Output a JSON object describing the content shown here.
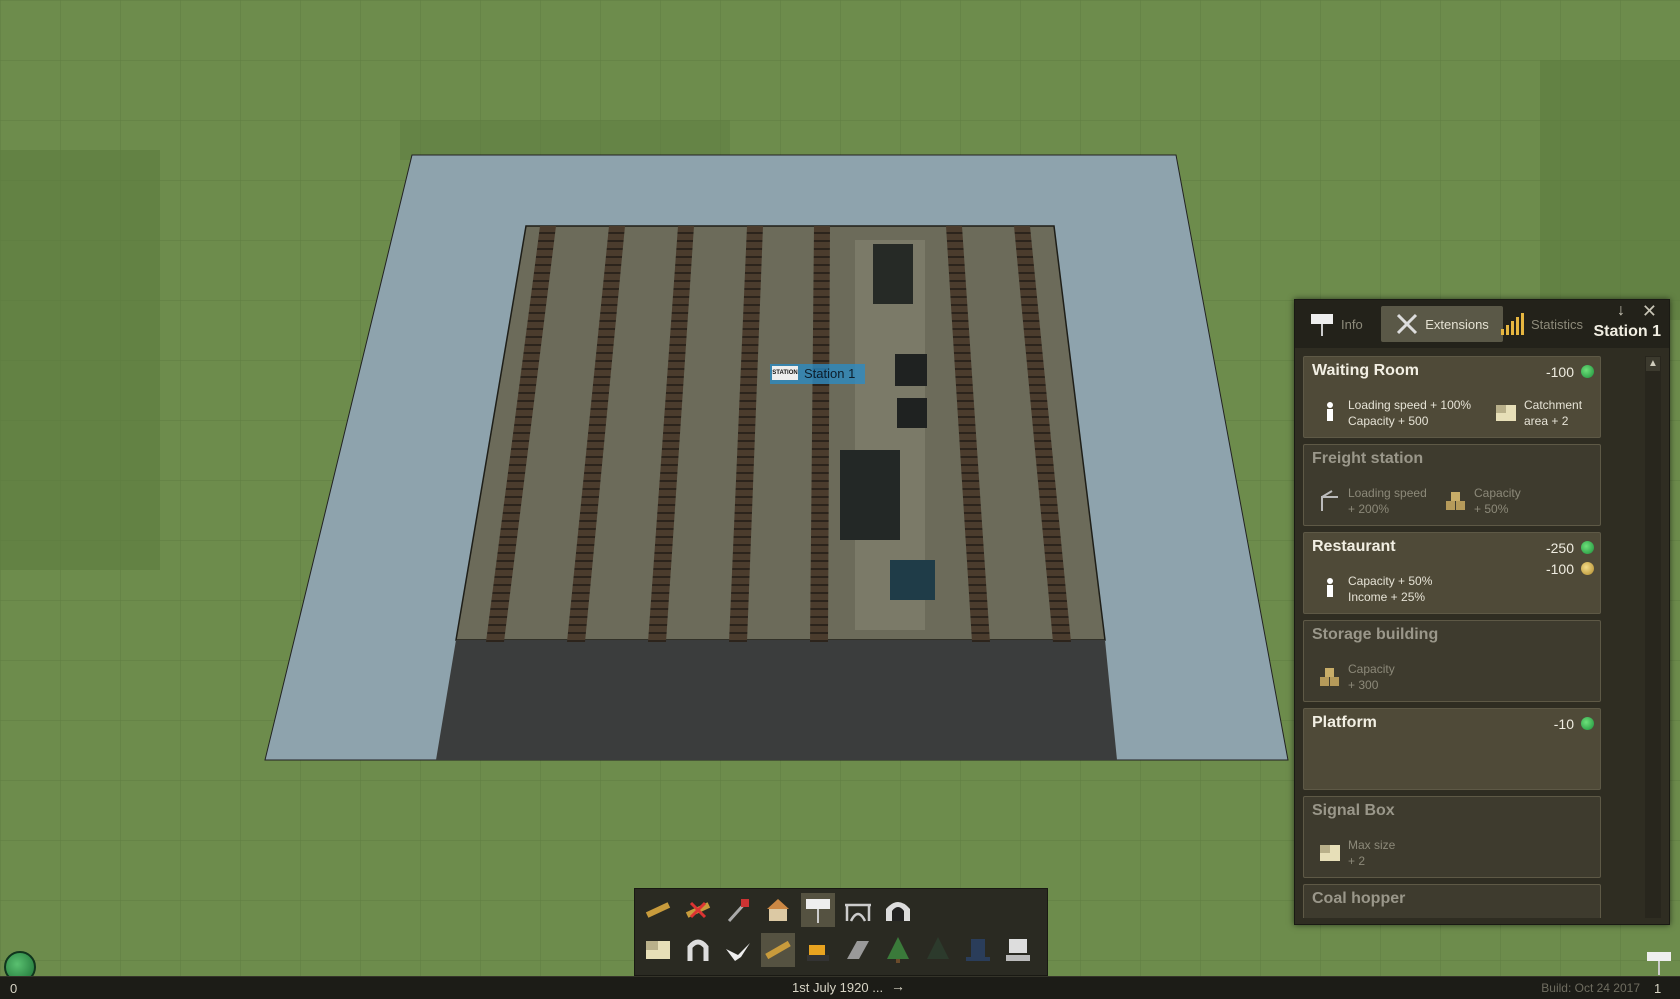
{
  "world": {
    "station_label": "Station 1",
    "station_sign_text": "STATION"
  },
  "panel": {
    "title": "Station 1",
    "tabs": [
      {
        "label": "Info",
        "icon": "station-sign-icon",
        "active": false
      },
      {
        "label": "Extensions",
        "icon": "wrench-screwdriver-icon",
        "active": true
      },
      {
        "label": "Statistics",
        "icon": "bar-chart-icon",
        "active": false
      }
    ],
    "extensions": [
      {
        "name": "Waiting Room",
        "available": true,
        "costs": [
          {
            "value": "-100",
            "currency": "green"
          }
        ],
        "bonuses": [
          {
            "icon": "passenger-icon",
            "lines": [
              "Loading speed + 100%",
              "Capacity + 500"
            ]
          },
          {
            "icon": "catchment-area-icon",
            "lines": [
              "Catchment",
              "area + 2"
            ]
          }
        ]
      },
      {
        "name": "Freight station",
        "available": false,
        "costs": [],
        "bonuses": [
          {
            "icon": "crane-icon",
            "lines": [
              "Loading speed",
              "+ 200%"
            ]
          },
          {
            "icon": "crates-icon",
            "lines": [
              "Capacity",
              "+ 50%"
            ]
          }
        ]
      },
      {
        "name": "Restaurant",
        "available": true,
        "costs": [
          {
            "value": "-250",
            "currency": "green"
          },
          {
            "value": "-100",
            "currency": "gold"
          }
        ],
        "bonuses": [
          {
            "icon": "passenger-icon",
            "lines": [
              "Capacity + 50%",
              "Income + 25%"
            ]
          }
        ]
      },
      {
        "name": "Storage building",
        "available": false,
        "costs": [],
        "bonuses": [
          {
            "icon": "crates-icon",
            "lines": [
              "Capacity",
              "+ 300"
            ]
          }
        ]
      },
      {
        "name": "Platform",
        "available": true,
        "costs": [
          {
            "value": "-10",
            "currency": "green"
          }
        ],
        "bonuses": []
      },
      {
        "name": "Signal Box",
        "available": false,
        "costs": [],
        "bonuses": [
          {
            "icon": "catchment-area-icon",
            "lines": [
              "Max size",
              "+ 2"
            ]
          }
        ]
      },
      {
        "name": "Coal hopper",
        "available": false,
        "costs": [],
        "bonuses": []
      }
    ]
  },
  "toolbar": {
    "row1": [
      "ruler-icon",
      "demolish-icon",
      "axe-icon",
      "building-icon",
      "station-sign-icon",
      "bridge-icon",
      "tunnel-icon"
    ],
    "row2": [
      "terrain-icon",
      "magnet-icon",
      "bird-icon",
      "measure-icon",
      "bulldozer-icon",
      "pavement-icon",
      "tree-icon",
      "forest-icon",
      "hat-icon",
      "computer-icon"
    ],
    "selected_row1": 4,
    "selected_row2": 3
  },
  "status_bar": {
    "date": "1st July 1920 ...",
    "build": "Build: Oct 24 2017",
    "money_count": "0",
    "station_count": "1"
  },
  "colors": {
    "grass": "#6b8a4a",
    "panel_bg": "#2f2d22",
    "green_coin": "#1c8f3a",
    "gold_coin": "#b08a2a",
    "station_label": "#288cc8"
  }
}
